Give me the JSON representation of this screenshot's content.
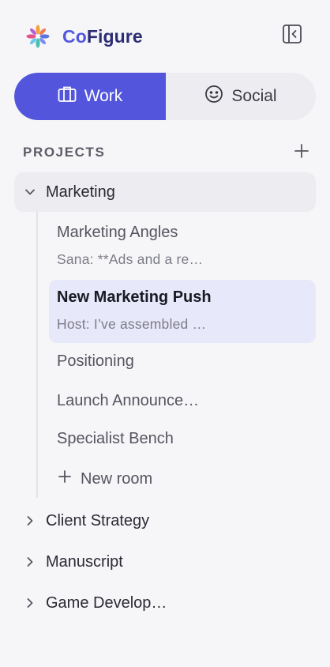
{
  "app": {
    "brand_prefix": "Co",
    "brand_suffix": "Figure",
    "accent": "#5356dc"
  },
  "mode_toggle": {
    "work_label": "Work",
    "social_label": "Social",
    "selected": "Work"
  },
  "projects": {
    "heading": "PROJECTS",
    "list": [
      {
        "label": "Marketing",
        "expanded": true,
        "rooms": [
          {
            "title": "Marketing Angles",
            "subtitle": "Sana: **Ads and a re…"
          },
          {
            "title": "New Marketing Push",
            "subtitle": "Host: I’ve assembled …",
            "active": true
          },
          {
            "title": "Positioning"
          },
          {
            "title": "Launch Announce…"
          },
          {
            "title": "Specialist Bench"
          }
        ],
        "new_room_label": "New room"
      },
      {
        "label": "Client Strategy",
        "expanded": false
      },
      {
        "label": "Manuscript",
        "expanded": false
      },
      {
        "label": "Game Develop…",
        "expanded": false
      }
    ]
  }
}
